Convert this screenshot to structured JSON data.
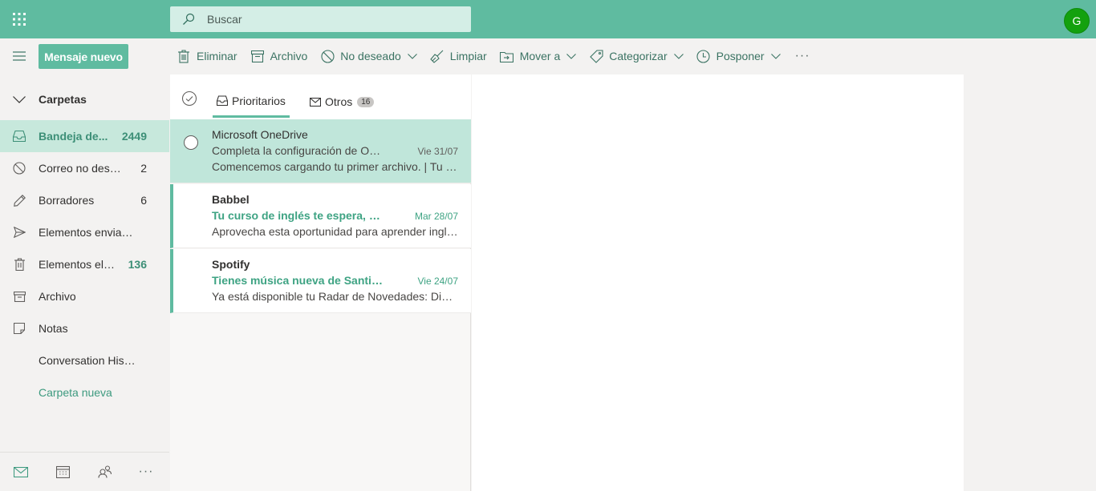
{
  "header": {
    "search_placeholder": "Buscar",
    "avatar_initial": "G",
    "accent_color": "#5fbba0",
    "avatar_color": "#13a10e"
  },
  "commands": {
    "new_message": "Mensaje nuevo",
    "delete": "Eliminar",
    "archive": "Archivo",
    "junk": "No deseado",
    "sweep": "Limpiar",
    "move_to": "Mover a",
    "categorize": "Categorizar",
    "snooze": "Posponer",
    "more": "···"
  },
  "folders": {
    "header": "Carpetas",
    "items": [
      {
        "label": "Bandeja de...",
        "count": "2449",
        "icon": "inbox-icon"
      },
      {
        "label": "Correo no deseado",
        "count": "2",
        "icon": "junk-icon"
      },
      {
        "label": "Borradores",
        "count": "6",
        "icon": "pencil-icon"
      },
      {
        "label": "Elementos enviados",
        "count": "",
        "icon": "send-icon"
      },
      {
        "label": "Elementos eliminados",
        "count": "136",
        "icon": "trash-icon"
      },
      {
        "label": "Archivo",
        "count": "",
        "icon": "archive-icon"
      },
      {
        "label": "Notas",
        "count": "",
        "icon": "note-icon"
      },
      {
        "label": "Conversation History",
        "count": "",
        "icon": ""
      },
      {
        "label": "Carpeta nueva",
        "count": "",
        "icon": ""
      }
    ]
  },
  "bottom_nav": {
    "more": "···"
  },
  "tabs": {
    "focused": "Prioritarios",
    "other": "Otros",
    "other_count": "16"
  },
  "messages": [
    {
      "sender": "Microsoft OneDrive",
      "subject": "Completa la configuración de OneDrive",
      "date": "Vie 31/07",
      "preview": "Comencemos cargando tu primer archivo. | Tu espacio"
    },
    {
      "sender": "Babbel",
      "subject": "Tu curso de inglés te espera, ahora",
      "date": "Mar 28/07",
      "preview": "Aprovecha esta oportunidad para aprender inglés"
    },
    {
      "sender": "Spotify",
      "subject": "Tienes música nueva de Santiago",
      "date": "Vie 24/07",
      "preview": "Ya está disponible tu Radar de Novedades: Disfrútalo"
    }
  ]
}
